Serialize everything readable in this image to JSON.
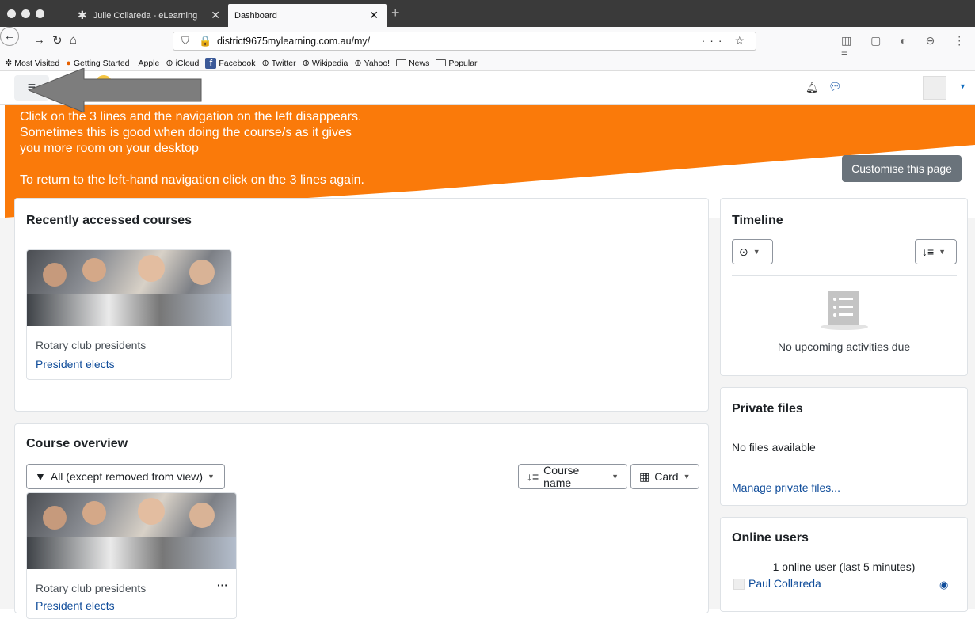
{
  "browser": {
    "tabs": [
      {
        "label": "Julie Collareda - eLearning",
        "close": "✕"
      },
      {
        "label": "Dashboard",
        "close": "✕"
      }
    ],
    "new_tab": "+",
    "url": "district9675mylearning.com.au/my/",
    "url_actions": "··· ☆",
    "bookmarks": [
      "Most Visited",
      "Getting Started",
      "Apple",
      "iCloud",
      "Facebook",
      "Twitter",
      "Wikipedia",
      "Yahoo!",
      "News",
      "Popular"
    ]
  },
  "header": {
    "logo_text": "D"
  },
  "banner": {
    "line1": "Click on the 3 lines and the navigation on the left disappears.",
    "line2": "Sometimes this is good when doing the course/s as it gives",
    "line3": "you more room on your desktop",
    "line4": "To return to the left-hand navigation click on the 3 lines again.",
    "color": "#fa7a0a"
  },
  "customise_button": "Customise this page",
  "recent": {
    "title": "Recently accessed courses",
    "course": {
      "category": "Rotary club presidents",
      "name": "President elects"
    }
  },
  "overview": {
    "title": "Course overview",
    "filter": "All (except removed from view)",
    "sort": "Course name",
    "view": "Card",
    "course": {
      "category": "Rotary club presidents",
      "name": "President elects",
      "menu": "···"
    }
  },
  "timeline": {
    "title": "Timeline",
    "empty": "No upcoming activities due"
  },
  "private_files": {
    "title": "Private files",
    "empty": "No files available",
    "manage": "Manage private files..."
  },
  "online_users": {
    "title": "Online users",
    "summary": "1 online user (last 5 minutes)",
    "user": "Paul Collareda"
  },
  "colors": {
    "link": "#0f4c9a",
    "banner": "#fa7a0a",
    "button_grey": "#6a737b"
  }
}
